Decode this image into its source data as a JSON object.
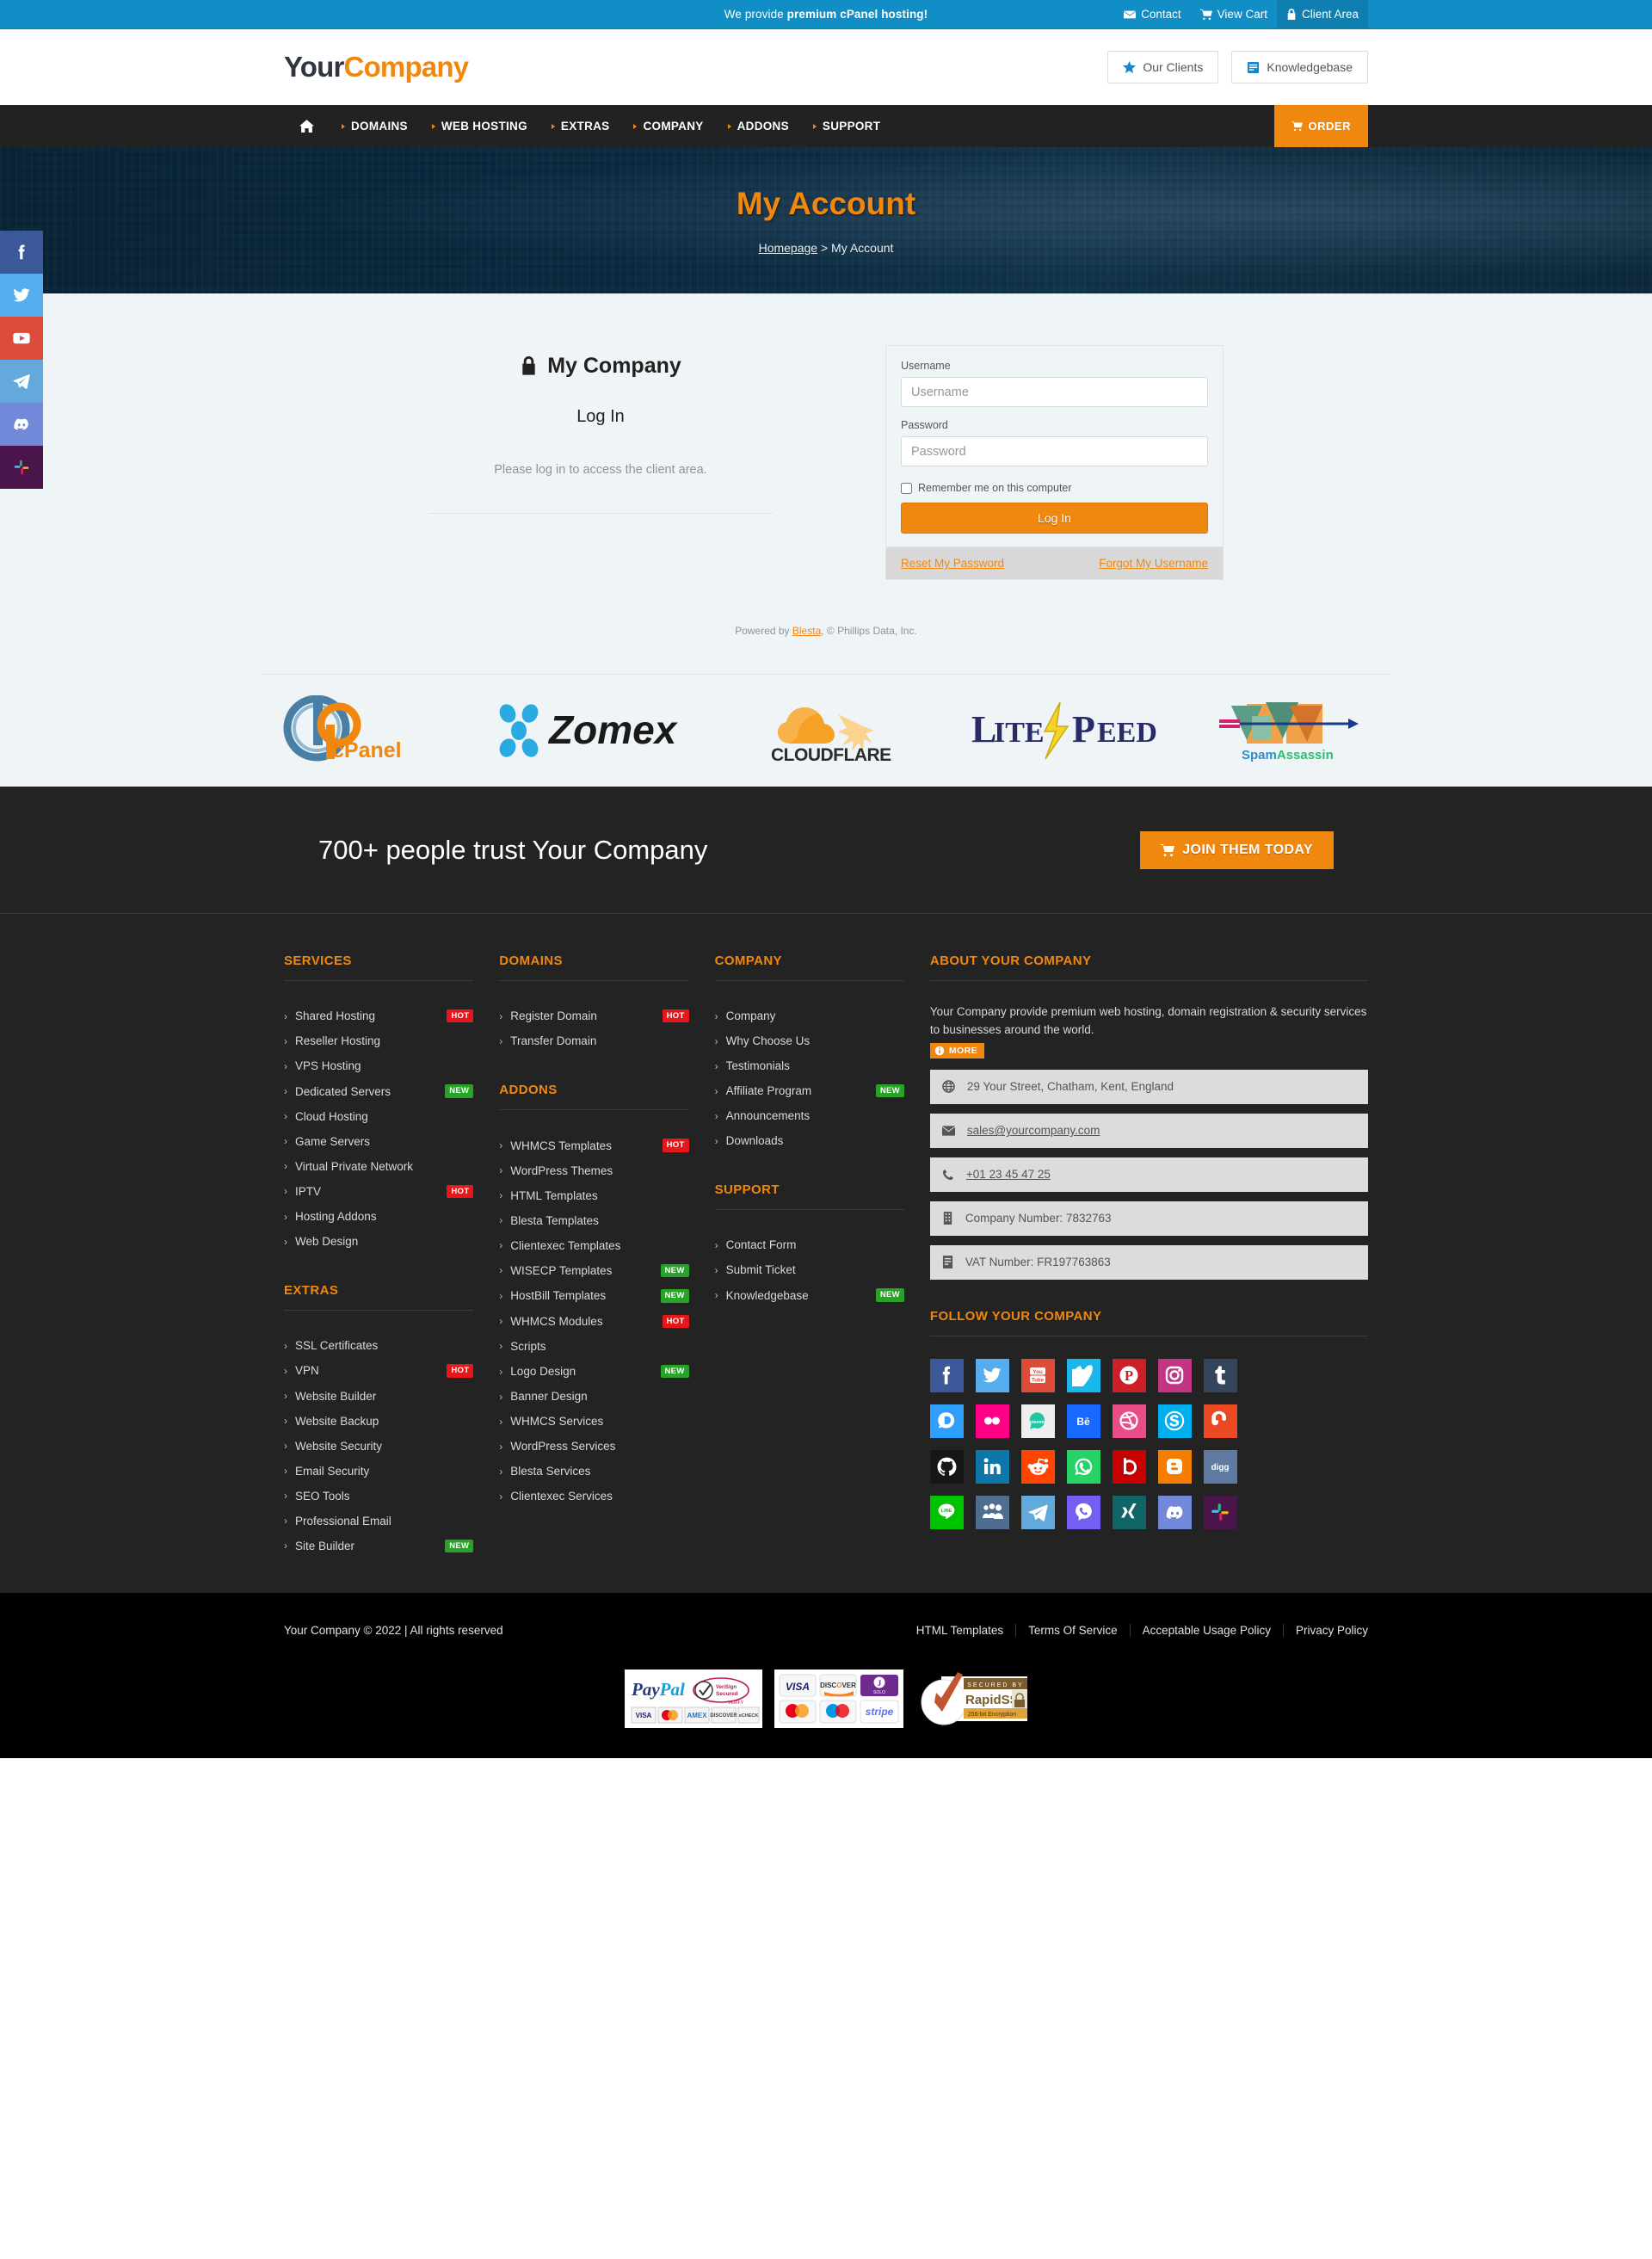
{
  "topbar": {
    "slogan_prefix": "We provide ",
    "slogan_bold": "premium cPanel hosting!",
    "links": [
      {
        "label": "Contact",
        "icon": "envelope-icon"
      },
      {
        "label": "View Cart",
        "icon": "cart-icon"
      },
      {
        "label": "Client Area",
        "icon": "lock-icon"
      }
    ]
  },
  "header": {
    "logo_part1": "Your",
    "logo_part2": "Company",
    "buttons": [
      {
        "label": "Our Clients",
        "icon": "star-icon"
      },
      {
        "label": "Knowledgebase",
        "icon": "book-icon"
      }
    ]
  },
  "nav": {
    "home_icon": "home-icon",
    "items": [
      "DOMAINS",
      "WEB HOSTING",
      "EXTRAS",
      "COMPANY",
      "ADDONS",
      "SUPPORT"
    ],
    "order_label": "ORDER"
  },
  "hero": {
    "title": "My Account",
    "breadcrumb_home": "Homepage",
    "breadcrumb_sep": " > ",
    "breadcrumb_current": "My Account"
  },
  "login": {
    "panel_title": "My Company",
    "panel_subtitle": "Log In",
    "panel_text": "Please log in to access the client area.",
    "username_label": "Username",
    "username_placeholder": "Username",
    "username_value": "",
    "password_label": "Password",
    "password_placeholder": "Password",
    "password_value": "",
    "remember_label": "Remember me on this computer",
    "submit_label": "Log In",
    "reset_password_label": "Reset My Password",
    "forgot_username_label": "Forgot My Username",
    "powered_prefix": "Powered by ",
    "powered_link": "Blesta",
    "powered_suffix": ", © Phillips Data, Inc."
  },
  "brands": [
    {
      "name": "cPanel"
    },
    {
      "name": "Zomex"
    },
    {
      "name": "CLOUDFLARE"
    },
    {
      "name": "LITESPEED"
    },
    {
      "name": "SpamAssassin"
    }
  ],
  "cta": {
    "text": "700+ people trust Your Company",
    "button_label": "JOIN THEM TODAY",
    "button_icon": "cart-icon"
  },
  "footer": {
    "services": {
      "heading": "SERVICES",
      "items": [
        {
          "label": "Shared Hosting",
          "badge": "HOT",
          "badge_type": "hot"
        },
        {
          "label": "Reseller Hosting",
          "badge": "",
          "badge_type": ""
        },
        {
          "label": "VPS Hosting",
          "badge": "",
          "badge_type": ""
        },
        {
          "label": "Dedicated Servers",
          "badge": "NEW",
          "badge_type": "new"
        },
        {
          "label": "Cloud Hosting",
          "badge": "",
          "badge_type": ""
        },
        {
          "label": "Game Servers",
          "badge": "",
          "badge_type": ""
        },
        {
          "label": "Virtual Private Network",
          "badge": "",
          "badge_type": ""
        },
        {
          "label": "IPTV",
          "badge": "HOT",
          "badge_type": "hot"
        },
        {
          "label": "Hosting Addons",
          "badge": "",
          "badge_type": ""
        },
        {
          "label": "Web Design",
          "badge": "",
          "badge_type": ""
        }
      ]
    },
    "extras": {
      "heading": "EXTRAS",
      "items": [
        {
          "label": "SSL Certificates",
          "badge": "",
          "badge_type": ""
        },
        {
          "label": "VPN",
          "badge": "HOT",
          "badge_type": "hot"
        },
        {
          "label": "Website Builder",
          "badge": "",
          "badge_type": ""
        },
        {
          "label": "Website Backup",
          "badge": "",
          "badge_type": ""
        },
        {
          "label": "Website Security",
          "badge": "",
          "badge_type": ""
        },
        {
          "label": "Email Security",
          "badge": "",
          "badge_type": ""
        },
        {
          "label": "SEO Tools",
          "badge": "",
          "badge_type": ""
        },
        {
          "label": "Professional Email",
          "badge": "",
          "badge_type": ""
        },
        {
          "label": "Site Builder",
          "badge": "NEW",
          "badge_type": "new"
        }
      ]
    },
    "domains": {
      "heading": "DOMAINS",
      "items": [
        {
          "label": "Register Domain",
          "badge": "HOT",
          "badge_type": "hot"
        },
        {
          "label": "Transfer Domain",
          "badge": "",
          "badge_type": ""
        }
      ]
    },
    "addons": {
      "heading": "ADDONS",
      "items": [
        {
          "label": "WHMCS Templates",
          "badge": "HOT",
          "badge_type": "hot"
        },
        {
          "label": "WordPress Themes",
          "badge": "",
          "badge_type": ""
        },
        {
          "label": "HTML Templates",
          "badge": "",
          "badge_type": ""
        },
        {
          "label": "Blesta Templates",
          "badge": "",
          "badge_type": ""
        },
        {
          "label": "Clientexec Templates",
          "badge": "",
          "badge_type": ""
        },
        {
          "label": "WISECP Templates",
          "badge": "NEW",
          "badge_type": "new"
        },
        {
          "label": "HostBill Templates",
          "badge": "NEW",
          "badge_type": "new"
        },
        {
          "label": "WHMCS Modules",
          "badge": "HOT",
          "badge_type": "hot"
        },
        {
          "label": "Scripts",
          "badge": "",
          "badge_type": ""
        },
        {
          "label": "Logo Design",
          "badge": "NEW",
          "badge_type": "new"
        },
        {
          "label": "Banner Design",
          "badge": "",
          "badge_type": ""
        },
        {
          "label": "WHMCS Services",
          "badge": "",
          "badge_type": ""
        },
        {
          "label": "WordPress Services",
          "badge": "",
          "badge_type": ""
        },
        {
          "label": "Blesta Services",
          "badge": "",
          "badge_type": ""
        },
        {
          "label": "Clientexec Services",
          "badge": "",
          "badge_type": ""
        }
      ]
    },
    "company": {
      "heading": "COMPANY",
      "items": [
        {
          "label": "Company",
          "badge": "",
          "badge_type": ""
        },
        {
          "label": "Why Choose Us",
          "badge": "",
          "badge_type": ""
        },
        {
          "label": "Testimonials",
          "badge": "",
          "badge_type": ""
        },
        {
          "label": "Affiliate Program",
          "badge": "NEW",
          "badge_type": "new"
        },
        {
          "label": "Announcements",
          "badge": "",
          "badge_type": ""
        },
        {
          "label": "Downloads",
          "badge": "",
          "badge_type": ""
        }
      ]
    },
    "support": {
      "heading": "SUPPORT",
      "items": [
        {
          "label": "Contact Form",
          "badge": "",
          "badge_type": ""
        },
        {
          "label": "Submit Ticket",
          "badge": "",
          "badge_type": ""
        },
        {
          "label": "Knowledgebase",
          "badge": "NEW",
          "badge_type": "new"
        }
      ]
    },
    "about": {
      "heading": "ABOUT YOUR COMPANY",
      "description": "Your Company provide premium web hosting, domain registration & security services to businesses around the world.",
      "more_label": "MORE",
      "address": "29 Your Street, Chatham, Kent, England",
      "email": "sales@yourcompany.com",
      "phone": "+01 23 45 47 25",
      "company_number": "Company Number: 7832763",
      "vat_number": "VAT Number: FR197763863"
    },
    "follow": {
      "heading": "FOLLOW YOUR COMPANY",
      "networks": [
        {
          "name": "facebook",
          "color": "#3b5998"
        },
        {
          "name": "twitter",
          "color": "#55acee"
        },
        {
          "name": "youtube",
          "color": "#dd4b39"
        },
        {
          "name": "vimeo",
          "color": "#1ab7ea"
        },
        {
          "name": "pinterest",
          "color": "#cb2027"
        },
        {
          "name": "instagram",
          "color": "#c13584"
        },
        {
          "name": "tumblr",
          "color": "#35465c"
        },
        {
          "name": "disqus",
          "color": "#2e9fff"
        },
        {
          "name": "flickr",
          "color": "#ff0084"
        },
        {
          "name": "steemit",
          "color": "#eeeeee"
        },
        {
          "name": "behance",
          "color": "#1769ff"
        },
        {
          "name": "dribbble",
          "color": "#ea4c89"
        },
        {
          "name": "skype",
          "color": "#00aff0"
        },
        {
          "name": "stumbleupon",
          "color": "#eb4924"
        },
        {
          "name": "github",
          "color": "#171515"
        },
        {
          "name": "linkedin",
          "color": "#0e76a8"
        },
        {
          "name": "reddit",
          "color": "#ff4500"
        },
        {
          "name": "whatsapp",
          "color": "#25d366"
        },
        {
          "name": "bebo",
          "color": "#c70000"
        },
        {
          "name": "blogger",
          "color": "#f57d00"
        },
        {
          "name": "digg",
          "color": "#5e7aa1"
        },
        {
          "name": "line",
          "color": "#00c300"
        },
        {
          "name": "myspace",
          "color": "#4f6d8e"
        },
        {
          "name": "telegram",
          "color": "#64a9dc"
        },
        {
          "name": "viber",
          "color": "#7360f2"
        },
        {
          "name": "xing",
          "color": "#126567"
        },
        {
          "name": "discord",
          "color": "#7289da"
        },
        {
          "name": "slack",
          "color": "#4a154b"
        }
      ]
    }
  },
  "bottom": {
    "copyright": "Your Company © 2022 | All rights reserved",
    "links": [
      "HTML Templates",
      "Terms Of Service",
      "Acceptable Usage Policy",
      "Privacy Policy"
    ],
    "payments": [
      "PayPal VeriSign Secured",
      "Visa Discover Solo MasterCard Maestro Stripe",
      "SECURED BY RapidSSL 256-bit Encryption"
    ]
  },
  "rail": [
    {
      "name": "facebook",
      "color": "#3b5998"
    },
    {
      "name": "twitter",
      "color": "#55acee"
    },
    {
      "name": "youtube",
      "color": "#dd4b39"
    },
    {
      "name": "telegram",
      "color": "#64a9dc"
    },
    {
      "name": "discord",
      "color": "#7289da"
    },
    {
      "name": "slack",
      "color": "#4a154b"
    }
  ]
}
